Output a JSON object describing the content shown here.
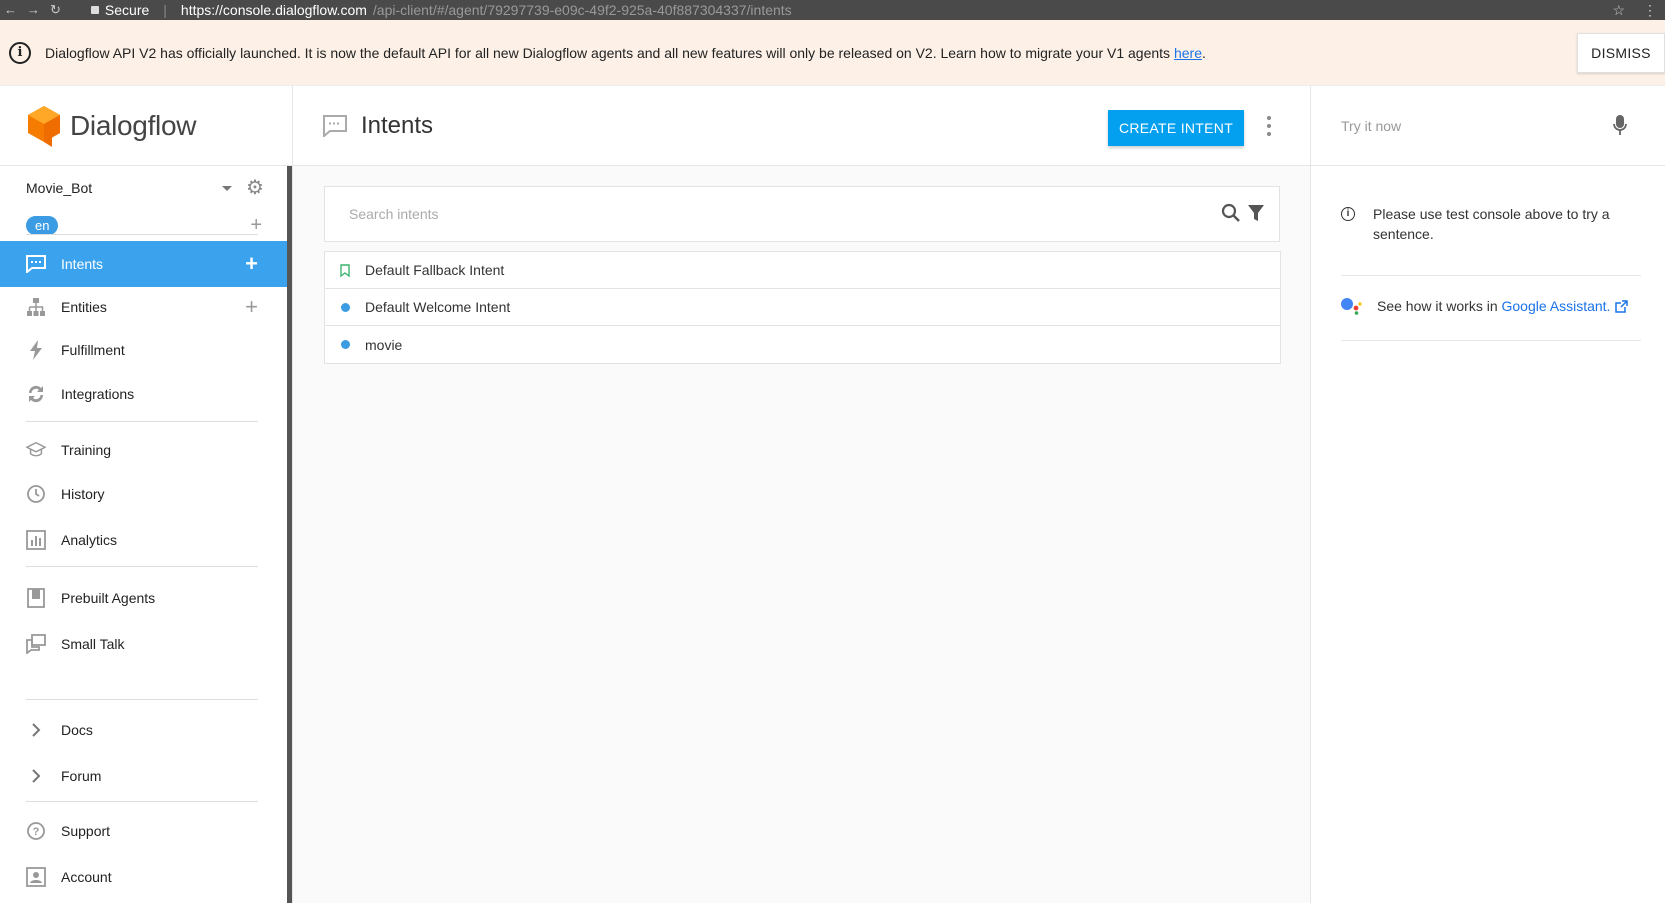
{
  "browser": {
    "secure_label": "Secure",
    "url_host": "https://console.dialogflow.com",
    "url_path": "/api-client/#/agent/7929773​9-e09c-49f2-925a-40f887304337/intents"
  },
  "banner": {
    "message": "Dialogflow API V2 has officially launched. It is now the default API for all new Dialogflow agents and all new features will only be released on V2. Learn how to migrate your V1 agents ",
    "link_text": "here",
    "suffix": ".",
    "dismiss_label": "DISMISS"
  },
  "brand": {
    "name": "Dialogflow",
    "color": "#f57c00"
  },
  "agent": {
    "name": "Movie_Bot",
    "language": "en"
  },
  "sidebar": {
    "items": [
      {
        "label": "Intents",
        "icon": "chat-icon",
        "active": true
      },
      {
        "label": "Entities",
        "icon": "hierarchy-icon"
      },
      {
        "label": "Fulfillment",
        "icon": "bolt-icon"
      },
      {
        "label": "Integrations",
        "icon": "sync-icon"
      },
      {
        "label": "Training",
        "icon": "graduation-cap-icon"
      },
      {
        "label": "History",
        "icon": "clock-icon"
      },
      {
        "label": "Analytics",
        "icon": "bar-chart-icon"
      },
      {
        "label": "Prebuilt Agents",
        "icon": "book-icon"
      },
      {
        "label": "Small Talk",
        "icon": "chat-bubbles-icon"
      },
      {
        "label": "Docs",
        "icon": "chevron-right-icon"
      },
      {
        "label": "Forum",
        "icon": "chevron-right-icon"
      },
      {
        "label": "Support",
        "icon": "help-icon"
      },
      {
        "label": "Account",
        "icon": "account-icon"
      }
    ]
  },
  "header": {
    "title": "Intents",
    "create_label": "CREATE INTENT"
  },
  "search": {
    "placeholder": "Search intents"
  },
  "intents": [
    {
      "name": "Default Fallback Intent",
      "marker": "bookmark"
    },
    {
      "name": "Default Welcome Intent",
      "marker": "dot"
    },
    {
      "name": "movie",
      "marker": "dot"
    }
  ],
  "test_console": {
    "placeholder": "Try it now",
    "hint": "Please use test console above to try a sentence.",
    "assistant_prefix": "See how it works in ",
    "assistant_link": "Google Assistant."
  },
  "colors": {
    "accent": "#3ba2ee",
    "primary_button": "#04a0f0",
    "banner_bg": "#fdf1e7"
  }
}
